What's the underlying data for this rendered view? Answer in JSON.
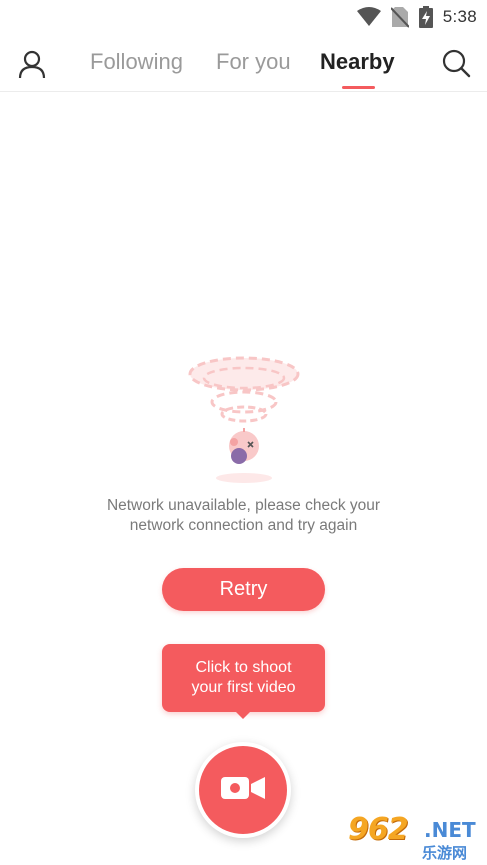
{
  "status_bar": {
    "time": "5:38",
    "icons": [
      "wifi-icon",
      "no-sim-icon",
      "battery-charging-icon"
    ]
  },
  "top_nav": {
    "profile_icon": "person-icon",
    "search_icon": "search-icon",
    "tabs": [
      {
        "label": "Following",
        "active": false
      },
      {
        "label": "For you",
        "active": false
      },
      {
        "label": "Nearby",
        "active": true
      }
    ]
  },
  "empty_state": {
    "illustration": "no-network-illustration",
    "message_line1": "Network unavailable, please check your",
    "message_line2": "network connection and try again",
    "retry_label": "Retry"
  },
  "tooltip": {
    "line1": "Click to shoot",
    "line2": "your first video"
  },
  "record_button": {
    "icon": "video-camera-icon"
  },
  "watermark": {
    "logo": "962",
    "domain": ".NET",
    "cn_text": "乐游网"
  },
  "colors": {
    "accent": "#f45b5e",
    "tab_inactive": "#9a9a9a",
    "tab_active": "#222222",
    "message_text": "#7a7a7a"
  }
}
